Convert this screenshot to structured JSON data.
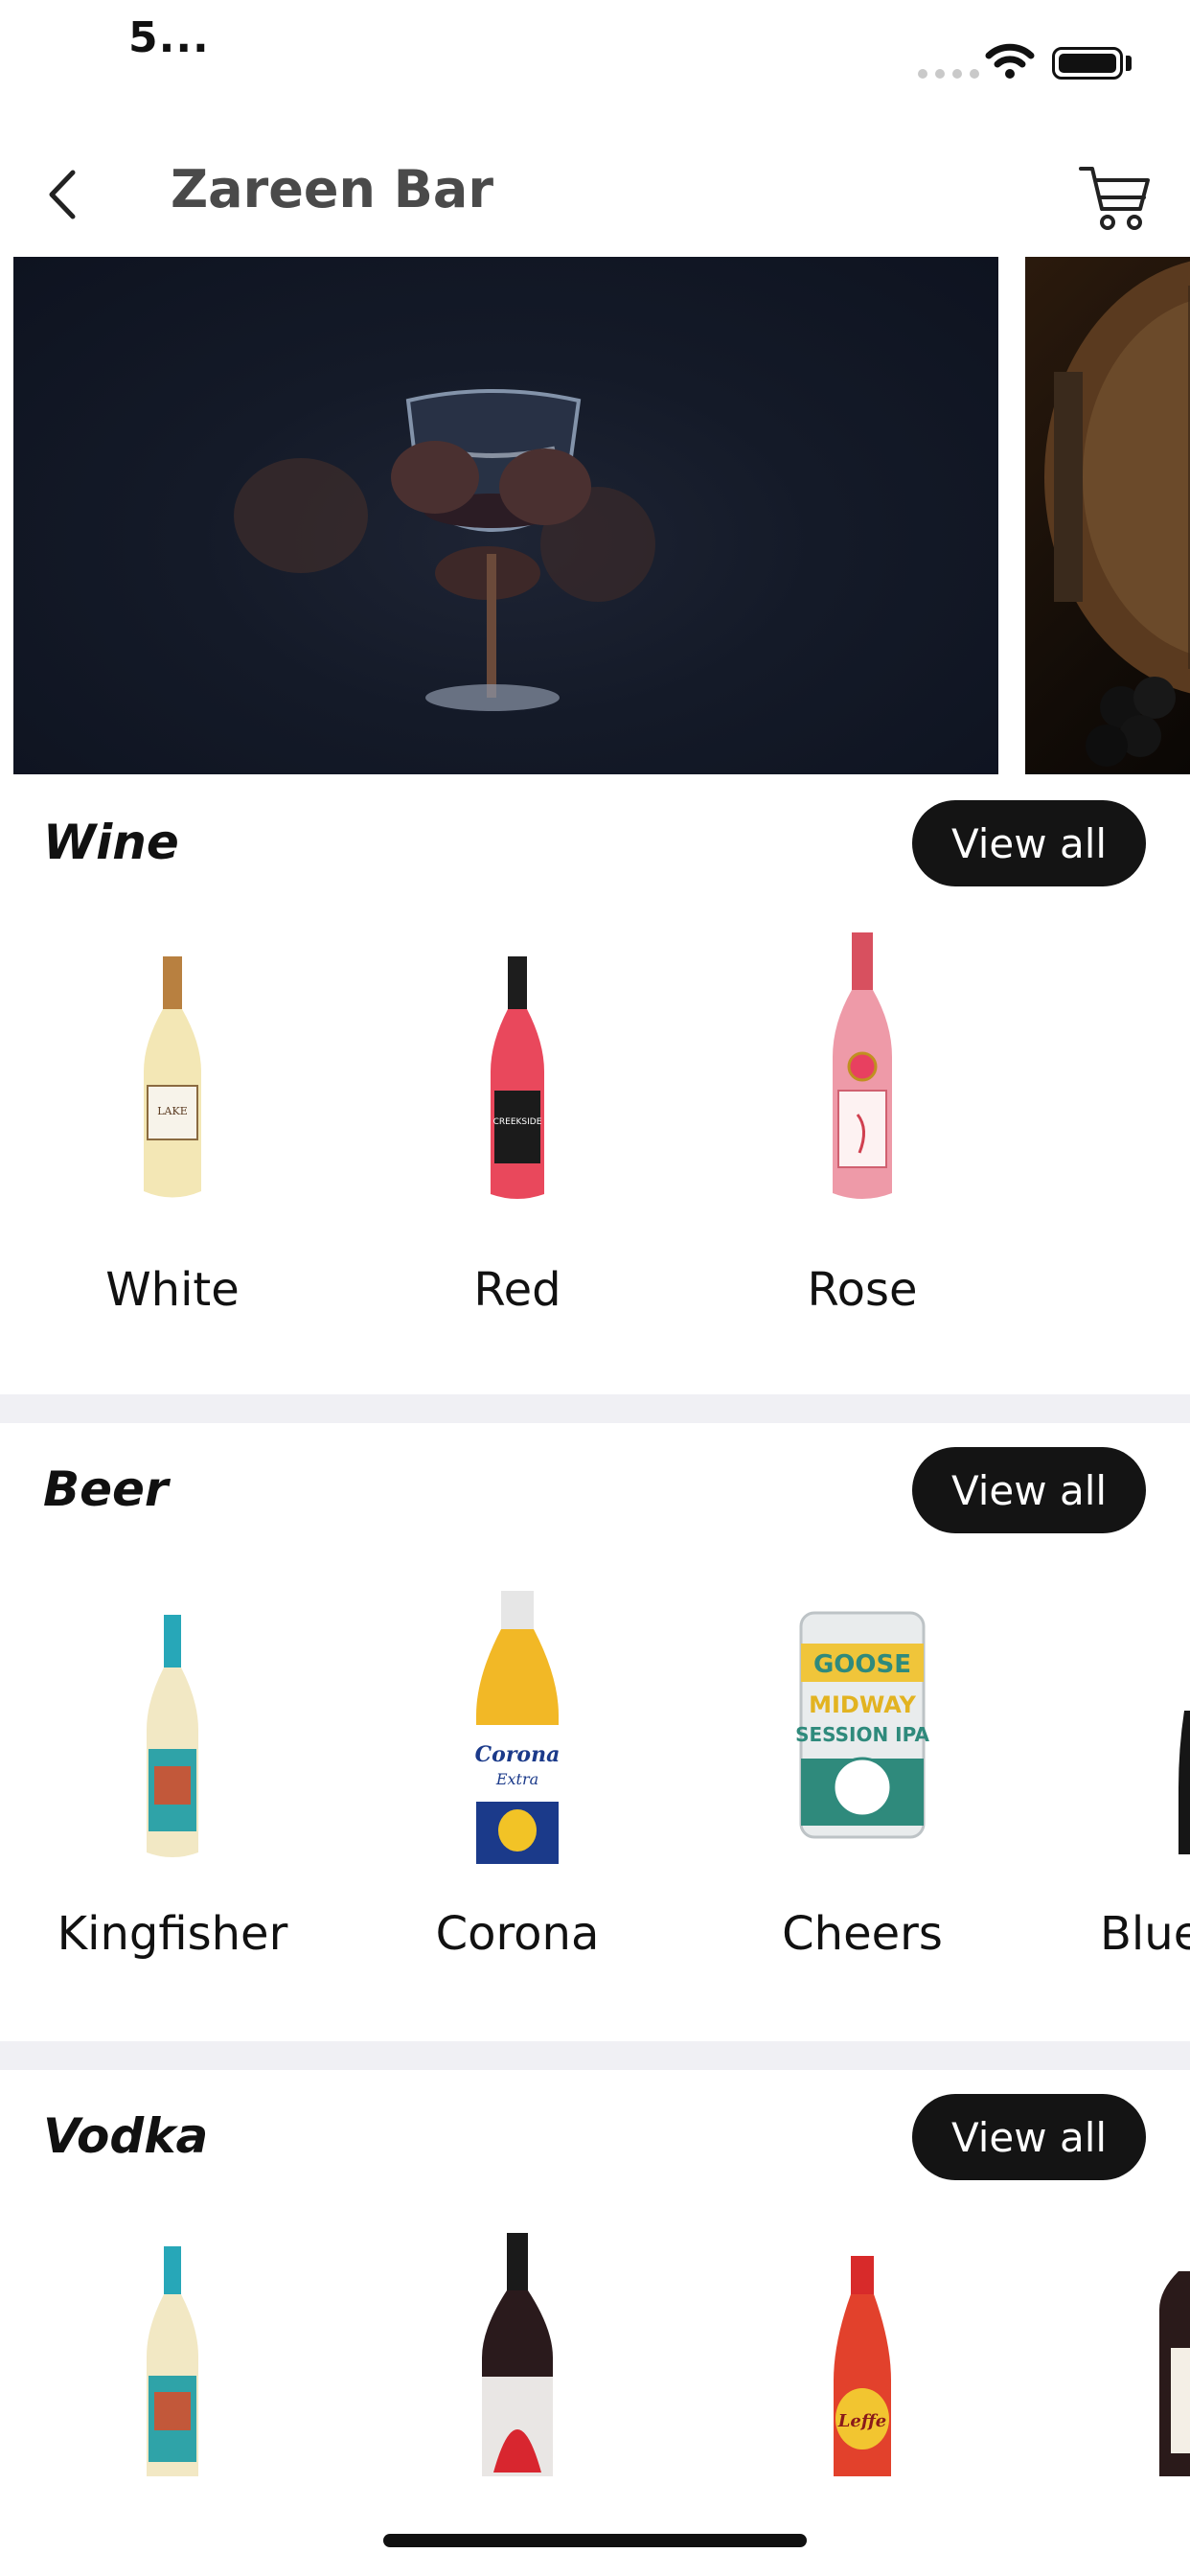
{
  "status_bar": {
    "time": "5..."
  },
  "header": {
    "title": "Zareen Bar"
  },
  "banner": {
    "slides": [
      "wine-glass-photo",
      "wine-barrel-photo"
    ]
  },
  "sections": [
    {
      "title": "Wine",
      "view_all_label": "View all",
      "products": [
        {
          "label": "White",
          "image": "white-wine-bottle"
        },
        {
          "label": "Red",
          "image": "red-wine-bottle"
        },
        {
          "label": "Rose",
          "image": "rose-wine-bottle"
        }
      ]
    },
    {
      "title": "Beer",
      "view_all_label": "View all",
      "products": [
        {
          "label": "Kingfisher",
          "image": "kingfisher-bottle"
        },
        {
          "label": "Corona",
          "image": "corona-bottle"
        },
        {
          "label": "Cheers",
          "image": "goose-island-can"
        },
        {
          "label": "Blue",
          "image": "blue-bottle"
        }
      ]
    },
    {
      "title": "Vodka",
      "view_all_label": "View all",
      "products": [
        {
          "image": "vodka-bottle-1"
        },
        {
          "image": "vodka-bottle-2"
        },
        {
          "image": "vodka-bottle-3"
        },
        {
          "image": "vodka-bottle-4"
        }
      ]
    }
  ],
  "colors": {
    "button_bg": "#141414",
    "divider": "#f0f0f4",
    "title_gray": "#4a4a4a"
  }
}
